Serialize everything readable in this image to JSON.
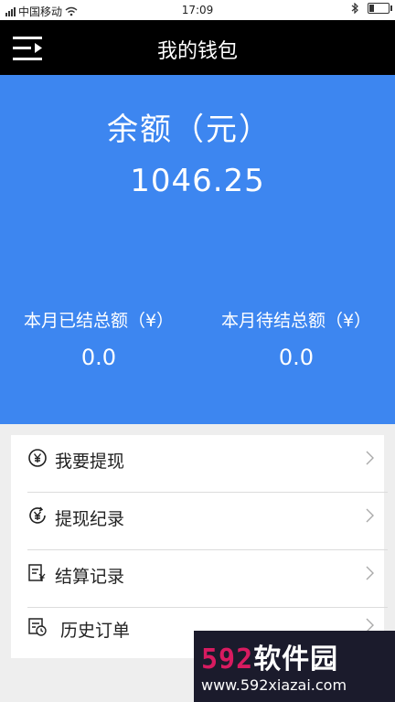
{
  "status_bar": {
    "carrier": "中国移动",
    "time": "17:09"
  },
  "header": {
    "title": "我的钱包"
  },
  "balance": {
    "label": "余额（元）",
    "value": "1046.25"
  },
  "stats": [
    {
      "label": "本月已结总额（¥）",
      "value": "0.0"
    },
    {
      "label": "本月待结总额（¥）",
      "value": "0.0"
    }
  ],
  "menu": {
    "items": [
      {
        "label": "我要提现",
        "icon": "yen-circle-icon"
      },
      {
        "label": "提现纪录",
        "icon": "yen-clock-icon"
      },
      {
        "label": "结算记录",
        "icon": "settlement-doc-icon"
      },
      {
        "label": "历史订单",
        "icon": "order-history-icon"
      }
    ]
  },
  "watermark": {
    "brand_number": "592",
    "brand_text": "软件园",
    "url": "www.592xiazai.com"
  },
  "colors": {
    "header_bg": "#000000",
    "balance_bg": "#3d86f0",
    "page_bg": "#eeeeee",
    "watermark_number": "#d81b60"
  }
}
